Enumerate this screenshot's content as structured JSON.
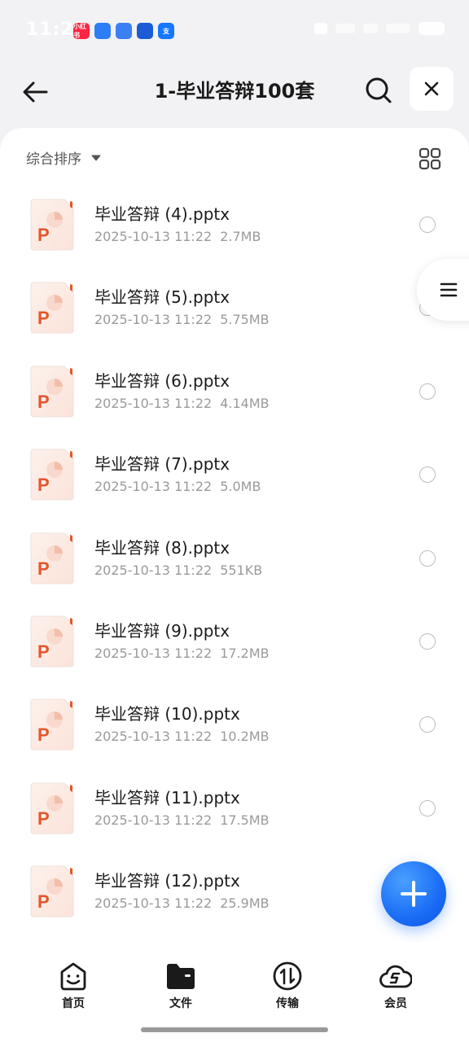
{
  "status_bar": {
    "time": "11:23",
    "app_icons": [
      {
        "name": "xiaohongshu-icon",
        "color": "#ff2442",
        "text": "小红书"
      },
      {
        "name": "messenger-icon",
        "color": "#2d7df6",
        "text": ""
      },
      {
        "name": "pill-app-icon",
        "color": "#3b7ff5",
        "text": ""
      },
      {
        "name": "baidu-app-icon",
        "color": "#1b5cd6",
        "text": ""
      },
      {
        "name": "alipay-icon",
        "color": "#1677ff",
        "text": "支"
      }
    ]
  },
  "header": {
    "title": "1-毕业答辩100套"
  },
  "sort_bar": {
    "label": "综合排序"
  },
  "files": [
    {
      "name": "毕业答辩 (4).pptx",
      "date": "2025-10-13 11:22",
      "size": "2.7MB"
    },
    {
      "name": "毕业答辩 (5).pptx",
      "date": "2025-10-13 11:22",
      "size": "5.75MB"
    },
    {
      "name": "毕业答辩 (6).pptx",
      "date": "2025-10-13 11:22",
      "size": "4.14MB"
    },
    {
      "name": "毕业答辩 (7).pptx",
      "date": "2025-10-13 11:22",
      "size": "5.0MB"
    },
    {
      "name": "毕业答辩 (8).pptx",
      "date": "2025-10-13 11:22",
      "size": "551KB"
    },
    {
      "name": "毕业答辩 (9).pptx",
      "date": "2025-10-13 11:22",
      "size": "17.2MB"
    },
    {
      "name": "毕业答辩 (10).pptx",
      "date": "2025-10-13 11:22",
      "size": "10.2MB"
    },
    {
      "name": "毕业答辩 (11).pptx",
      "date": "2025-10-13 11:22",
      "size": "17.5MB"
    },
    {
      "name": "毕业答辩 (12).pptx",
      "date": "2025-10-13 11:22",
      "size": "25.9MB"
    }
  ],
  "bottom_nav": [
    {
      "label": "首页",
      "icon": "smiley-home-icon"
    },
    {
      "label": "文件",
      "icon": "folder-icon"
    },
    {
      "label": "传输",
      "icon": "transfer-icon"
    },
    {
      "label": "会员",
      "icon": "cloud-vip-icon"
    }
  ],
  "colors": {
    "accent": "#1a6cf5",
    "ppt_orange": "#e5562a",
    "page_bg": "#f2f2f4"
  }
}
